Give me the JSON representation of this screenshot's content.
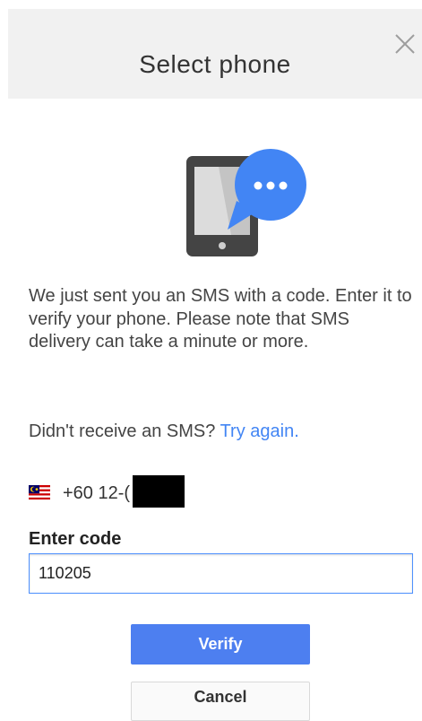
{
  "dialog": {
    "title": "Select phone",
    "close_icon": "close-icon"
  },
  "illustration": {
    "icon": "phone-sms-icon",
    "bubble_color": "#4285f4"
  },
  "message": "We just sent you an SMS with a code. Enter it to verify your phone. Please note that SMS delivery can take a minute or more.",
  "retry": {
    "prompt": "Didn't receive an SMS? ",
    "link": "Try again."
  },
  "phone": {
    "flag_icon": "malaysia-flag-icon",
    "number": "+60 12-(          )922"
  },
  "code": {
    "label": "Enter code",
    "value": "110205"
  },
  "buttons": {
    "verify": "Verify",
    "cancel": "Cancel"
  },
  "colors": {
    "accent": "#4d7ff0",
    "link": "#4285f4",
    "header_bg": "#f1f1f1"
  }
}
